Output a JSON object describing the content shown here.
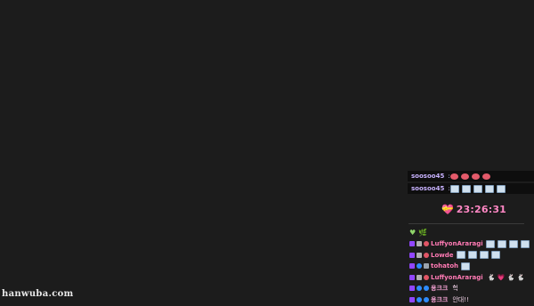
{
  "top_chat": [
    {
      "user": "soosoo45",
      "emote_type": "red",
      "emote_count": 4
    },
    {
      "user": "soosoo45",
      "emote_type": "pic",
      "emote_count": 5
    }
  ],
  "timer": {
    "time": "23:26:31",
    "heart": "💝"
  },
  "chat": [
    {
      "user": "LuffyonAraragi",
      "badges": [
        "purple",
        "gray",
        "red"
      ],
      "emotes": 4,
      "message": ""
    },
    {
      "user": "Lowde",
      "badges": [
        "purple",
        "gray",
        "red"
      ],
      "emotes": 4,
      "message": ""
    },
    {
      "user": "tohatoh",
      "badges": [
        "purple",
        "blue",
        "lock"
      ],
      "emotes": 1,
      "message": ""
    },
    {
      "user": "LuffyonAraragi",
      "badges": [
        "purple",
        "gray",
        "red"
      ],
      "emotes": 0,
      "message": "🐇 💗 🐇 🐇"
    },
    {
      "user": "용크크",
      "badges": [
        "purple",
        "blue",
        "blue"
      ],
      "emotes": 0,
      "message": "헉"
    },
    {
      "user": "용크크",
      "badges": [
        "purple",
        "blue",
        "blue"
      ],
      "emotes": 0,
      "message": "안대!!"
    }
  ],
  "watermark": "hanwuba.com"
}
